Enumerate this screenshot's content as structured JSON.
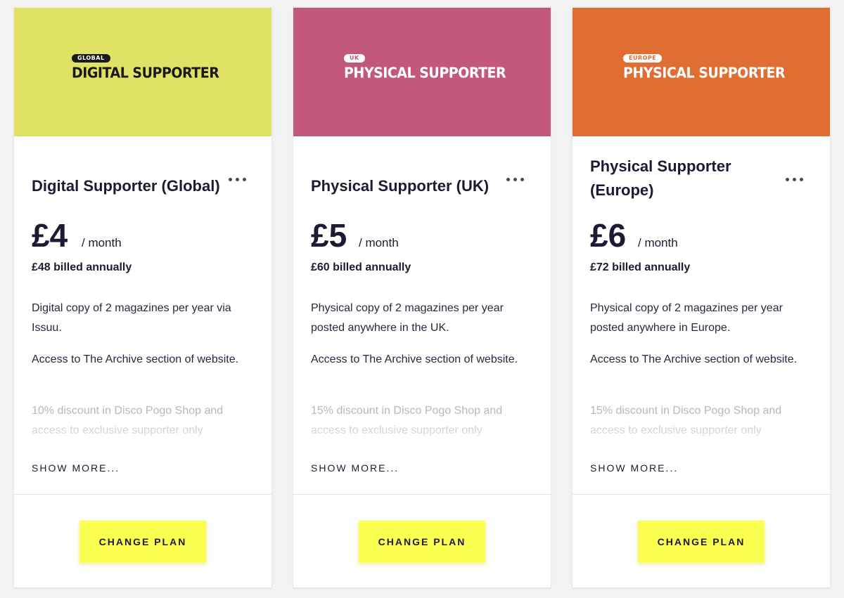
{
  "plans": [
    {
      "banner": {
        "badge": "GLOBAL",
        "title": "DIGITAL SUPPORTER",
        "bg": "#e0e265",
        "fg": "#1a1a1a",
        "badge_bg": "#1a1a1a",
        "badge_fg": "#ffffff"
      },
      "title": "Digital Supporter (Global)",
      "price": "£4",
      "period": "/ month",
      "billed": "£48 billed annually",
      "features": [
        "Digital copy of 2 magazines per year via Issuu.",
        "Access to The Archive section of website.",
        "10% discount in Disco Pogo Shop and access to exclusive supporter only"
      ],
      "show_more": "SHOW MORE...",
      "button": "CHANGE PLAN"
    },
    {
      "banner": {
        "badge": "UK",
        "title": "PHYSICAL SUPPORTER",
        "bg": "#c2587a",
        "fg": "#ffffff",
        "badge_bg": "#ffffff",
        "badge_fg": "#c2587a"
      },
      "title": "Physical Supporter (UK)",
      "price": "£5",
      "period": "/ month",
      "billed": "£60 billed annually",
      "features": [
        "Physical copy of 2 magazines per year posted anywhere in the UK.",
        "Access to The Archive section of website.",
        "15% discount in Disco Pogo Shop and access to exclusive supporter only"
      ],
      "show_more": "SHOW MORE...",
      "button": "CHANGE PLAN"
    },
    {
      "banner": {
        "badge": "EUROPE",
        "title": "PHYSICAL SUPPORTER",
        "bg": "#e06d31",
        "fg": "#ffffff",
        "badge_bg": "#ffffff",
        "badge_fg": "#e06d31"
      },
      "title": "Physical Supporter (Europe)",
      "price": "£6",
      "period": "/ month",
      "billed": "£72 billed annually",
      "features": [
        "Physical copy of 2 magazines per year posted anywhere in Europe.",
        "Access to The Archive section of website.",
        "15% discount in Disco Pogo Shop and access to exclusive supporter only"
      ],
      "show_more": "SHOW MORE...",
      "button": "CHANGE PLAN"
    }
  ],
  "icons": {
    "more": "more-horizontal-icon"
  },
  "colors": {
    "button": "#faff50",
    "text": "#1d1a33"
  }
}
